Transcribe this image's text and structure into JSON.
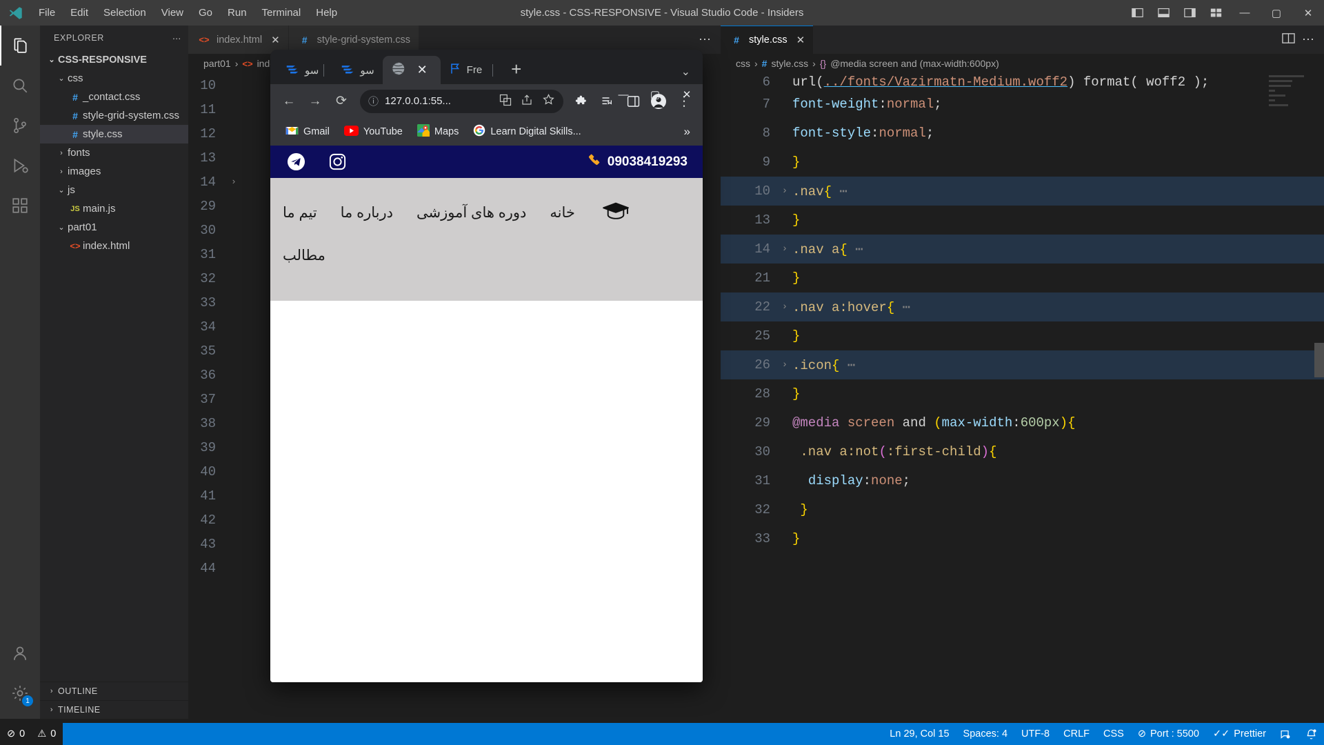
{
  "window": {
    "title": "style.css - CSS-RESPONSIVE - Visual Studio Code - Insiders",
    "minimize": "—",
    "maximize": "▢",
    "close": "✕"
  },
  "menubar": {
    "items": [
      "File",
      "Edit",
      "Selection",
      "View",
      "Go",
      "Run",
      "Terminal",
      "Help"
    ]
  },
  "activitybar": {
    "items": [
      {
        "name": "explorer-icon",
        "glyph": "files"
      },
      {
        "name": "search-icon",
        "glyph": "search"
      },
      {
        "name": "source-control-icon",
        "glyph": "branch"
      },
      {
        "name": "run-debug-icon",
        "glyph": "play"
      },
      {
        "name": "extensions-icon",
        "glyph": "blocks"
      }
    ],
    "bottom": [
      {
        "name": "accounts-icon",
        "glyph": "person"
      },
      {
        "name": "settings-gear-icon",
        "glyph": "gear",
        "badge": "1"
      }
    ]
  },
  "sidebar": {
    "header": "EXPLORER",
    "more": "⋯",
    "tree": [
      {
        "label": "CSS-RESPONSIVE",
        "type": "root",
        "indent": 0,
        "expanded": true
      },
      {
        "label": "css",
        "type": "folder",
        "indent": 1,
        "expanded": true
      },
      {
        "label": "_contact.css",
        "type": "css",
        "indent": 2
      },
      {
        "label": "style-grid-system.css",
        "type": "css",
        "indent": 2
      },
      {
        "label": "style.css",
        "type": "css",
        "indent": 2,
        "selected": true
      },
      {
        "label": "fonts",
        "type": "folder",
        "indent": 1,
        "expanded": false
      },
      {
        "label": "images",
        "type": "folder",
        "indent": 1,
        "expanded": false
      },
      {
        "label": "js",
        "type": "folder",
        "indent": 1,
        "expanded": true
      },
      {
        "label": "main.js",
        "type": "js",
        "indent": 2
      },
      {
        "label": "part01",
        "type": "folder",
        "indent": 1,
        "expanded": true
      },
      {
        "label": "index.html",
        "type": "html",
        "indent": 2
      }
    ],
    "panels": [
      "OUTLINE",
      "TIMELINE"
    ]
  },
  "editor_left": {
    "tabs": [
      {
        "label": "index.html",
        "icon": "html",
        "active": false,
        "close": "✕"
      },
      {
        "label": "style-grid-system.css",
        "icon": "css",
        "active": true
      }
    ],
    "more": "⋯",
    "breadcrumb": [
      "part01",
      "index.html"
    ],
    "line_numbers": [
      "10",
      "11",
      "12",
      "13",
      "14",
      "29",
      "30",
      "31",
      "32",
      "33",
      "34",
      "35",
      "36",
      "37",
      "38",
      "39",
      "40",
      "41",
      "42",
      "43",
      "44"
    ]
  },
  "editor_right": {
    "tab": {
      "label": "style.css",
      "icon": "css",
      "close": "✕"
    },
    "split_icon": "⫿⫿",
    "more_icon": "⋯",
    "breadcrumb": [
      "css",
      "style.css",
      "@media screen  and (max-width:600px)"
    ],
    "breadcrumb_brace": "{}",
    "lines": [
      {
        "num": "6",
        "fold": "",
        "highlight": false,
        "clipped": true,
        "tokens": [
          {
            "t": "url(",
            "c": "t-punc"
          },
          {
            "t": "../fonts/Vazirmatn-Medium.woff2",
            "c": "t-str"
          },
          {
            "t": ") format( woff2 );",
            "c": "t-punc"
          }
        ]
      },
      {
        "num": "7",
        "fold": "",
        "highlight": false,
        "tokens": [
          {
            "t": "    ",
            "c": "t-punc"
          },
          {
            "t": "font-weight",
            "c": "t-prop"
          },
          {
            "t": ":",
            "c": "t-punc"
          },
          {
            "t": "normal",
            "c": "t-val"
          },
          {
            "t": ";",
            "c": "t-punc"
          }
        ]
      },
      {
        "num": "8",
        "fold": "",
        "highlight": false,
        "tokens": [
          {
            "t": "    ",
            "c": "t-punc"
          },
          {
            "t": "font-style",
            "c": "t-prop"
          },
          {
            "t": ":",
            "c": "t-punc"
          },
          {
            "t": "normal",
            "c": "t-val"
          },
          {
            "t": ";",
            "c": "t-punc"
          }
        ]
      },
      {
        "num": "9",
        "fold": "",
        "highlight": false,
        "tokens": [
          {
            "t": "  ",
            "c": "t-punc"
          },
          {
            "t": "}",
            "c": "t-brace"
          }
        ]
      },
      {
        "num": "10",
        "fold": "›",
        "highlight": true,
        "tokens": [
          {
            "t": ".nav",
            "c": "t-sel"
          },
          {
            "t": "{",
            "c": "t-brace"
          },
          {
            "t": " ⋯",
            "c": "t-dots"
          }
        ]
      },
      {
        "num": "13",
        "fold": "",
        "highlight": false,
        "tokens": [
          {
            "t": "  ",
            "c": "t-punc"
          },
          {
            "t": "}",
            "c": "t-brace"
          }
        ]
      },
      {
        "num": "14",
        "fold": "›",
        "highlight": true,
        "tokens": [
          {
            "t": ".nav a",
            "c": "t-sel"
          },
          {
            "t": "{",
            "c": "t-brace"
          },
          {
            "t": " ⋯",
            "c": "t-dots"
          }
        ]
      },
      {
        "num": "21",
        "fold": "",
        "highlight": false,
        "tokens": [
          {
            "t": "  ",
            "c": "t-punc"
          },
          {
            "t": "}",
            "c": "t-brace"
          }
        ]
      },
      {
        "num": "22",
        "fold": "›",
        "highlight": true,
        "tokens": [
          {
            "t": ".nav a:hover",
            "c": "t-sel"
          },
          {
            "t": "{",
            "c": "t-brace"
          },
          {
            "t": " ⋯",
            "c": "t-dots"
          }
        ]
      },
      {
        "num": "25",
        "fold": "",
        "highlight": false,
        "tokens": [
          {
            "t": "  ",
            "c": "t-punc"
          },
          {
            "t": "}",
            "c": "t-brace"
          }
        ]
      },
      {
        "num": "26",
        "fold": "›",
        "highlight": true,
        "tokens": [
          {
            "t": ".icon",
            "c": "t-sel"
          },
          {
            "t": "{",
            "c": "t-brace"
          },
          {
            "t": " ⋯",
            "c": "t-dots"
          }
        ]
      },
      {
        "num": "28",
        "fold": "",
        "highlight": false,
        "tokens": [
          {
            "t": "  ",
            "c": "t-punc"
          },
          {
            "t": "}",
            "c": "t-brace"
          }
        ]
      },
      {
        "num": "29",
        "fold": "",
        "highlight": false,
        "tokens": [
          {
            "t": "  ",
            "c": "t-punc"
          },
          {
            "t": "@media",
            "c": "t-at"
          },
          {
            "t": " screen",
            "c": "t-kw"
          },
          {
            "t": " and ",
            "c": "t-punc"
          },
          {
            "t": "(",
            "c": "t-paren"
          },
          {
            "t": "max-width",
            "c": "t-blue"
          },
          {
            "t": ":",
            "c": "t-punc"
          },
          {
            "t": "600px",
            "c": "t-num"
          },
          {
            "t": ")",
            "c": "t-paren"
          },
          {
            "t": "{",
            "c": "t-brace"
          }
        ]
      },
      {
        "num": "30",
        "fold": "",
        "highlight": false,
        "tokens": [
          {
            "t": "    ",
            "c": "t-punc"
          },
          {
            "t": ".nav a:not",
            "c": "t-sel"
          },
          {
            "t": "(",
            "c": "t-paren2"
          },
          {
            "t": ":first-child",
            "c": "t-sel"
          },
          {
            "t": ")",
            "c": "t-paren2"
          },
          {
            "t": "{",
            "c": "t-brace"
          }
        ]
      },
      {
        "num": "31",
        "fold": "",
        "highlight": false,
        "tokens": [
          {
            "t": "      ",
            "c": "t-punc"
          },
          {
            "t": "display",
            "c": "t-prop"
          },
          {
            "t": ":",
            "c": "t-punc"
          },
          {
            "t": "none",
            "c": "t-val"
          },
          {
            "t": ";",
            "c": "t-punc"
          }
        ]
      },
      {
        "num": "32",
        "fold": "",
        "highlight": false,
        "tokens": [
          {
            "t": "    ",
            "c": "t-punc"
          },
          {
            "t": "}",
            "c": "t-brace"
          }
        ]
      },
      {
        "num": "33",
        "fold": "",
        "highlight": false,
        "tokens": [
          {
            "t": "  ",
            "c": "t-punc"
          },
          {
            "t": "}",
            "c": "t-brace"
          }
        ]
      }
    ]
  },
  "browser": {
    "tabs": [
      {
        "label": "سو",
        "icon": "blue-logo",
        "active": false
      },
      {
        "label": "سو",
        "icon": "blue-logo",
        "active": false
      },
      {
        "label": "",
        "icon": "globe",
        "active": true,
        "close": "✕"
      },
      {
        "label": "Fre",
        "icon": "flag",
        "active": false
      }
    ],
    "new_tab": "+",
    "chevron": "⌄",
    "window_controls": {
      "minimize": "—",
      "maximize": "▢",
      "close": "✕"
    },
    "toolbar": {
      "back": "←",
      "forward": "→",
      "reload": "⟳",
      "site_info": "ⓘ",
      "url": "127.0.0.1:55...",
      "translate_icon": "translate-icon",
      "share_icon": "share-icon",
      "bookmark_icon": "star-icon",
      "extensions_icon": "puzzle-icon",
      "reading_list_icon": "list-icon",
      "side_panel_icon": "panel-icon",
      "profile_icon": "person-icon",
      "menu_icon": "⋮"
    },
    "bookmarks": [
      {
        "label": "Gmail",
        "icon": "gmail-icon"
      },
      {
        "label": "YouTube",
        "icon": "youtube-icon"
      },
      {
        "label": "Maps",
        "icon": "maps-icon"
      },
      {
        "label": "Learn Digital Skills...",
        "icon": "google-icon"
      }
    ],
    "bookmarks_overflow": "»"
  },
  "site": {
    "topbar": {
      "telegram_icon": "telegram-icon",
      "instagram_icon": "instagram-icon",
      "phone_icon": "phone-icon",
      "phone": "09038419293",
      "bg": "#0d0d5c"
    },
    "nav": {
      "logo_icon": "graduation-cap-icon",
      "links": [
        "خانه",
        "دوره های آموزشی",
        "درباره ما",
        "تیم ما"
      ],
      "bg": "#cfcdcd"
    },
    "subtitle": "مطالب"
  },
  "statusbar": {
    "left": [
      {
        "name": "errors",
        "icon": "⊘",
        "label": "0"
      },
      {
        "name": "warnings",
        "icon": "⚠",
        "label": "0"
      }
    ],
    "right": [
      {
        "name": "cursor-position",
        "label": "Ln 29, Col 15"
      },
      {
        "name": "indentation",
        "label": "Spaces: 4"
      },
      {
        "name": "encoding",
        "label": "UTF-8"
      },
      {
        "name": "eol",
        "label": "CRLF"
      },
      {
        "name": "language-mode",
        "label": "CSS"
      },
      {
        "name": "live-server-port",
        "icon": "⊘",
        "label": "Port : 5500"
      },
      {
        "name": "prettier",
        "icon": "✓✓",
        "label": "Prettier"
      },
      {
        "name": "remote-feedback",
        "icon": "☷"
      },
      {
        "name": "notifications",
        "icon": "🔔"
      }
    ]
  }
}
